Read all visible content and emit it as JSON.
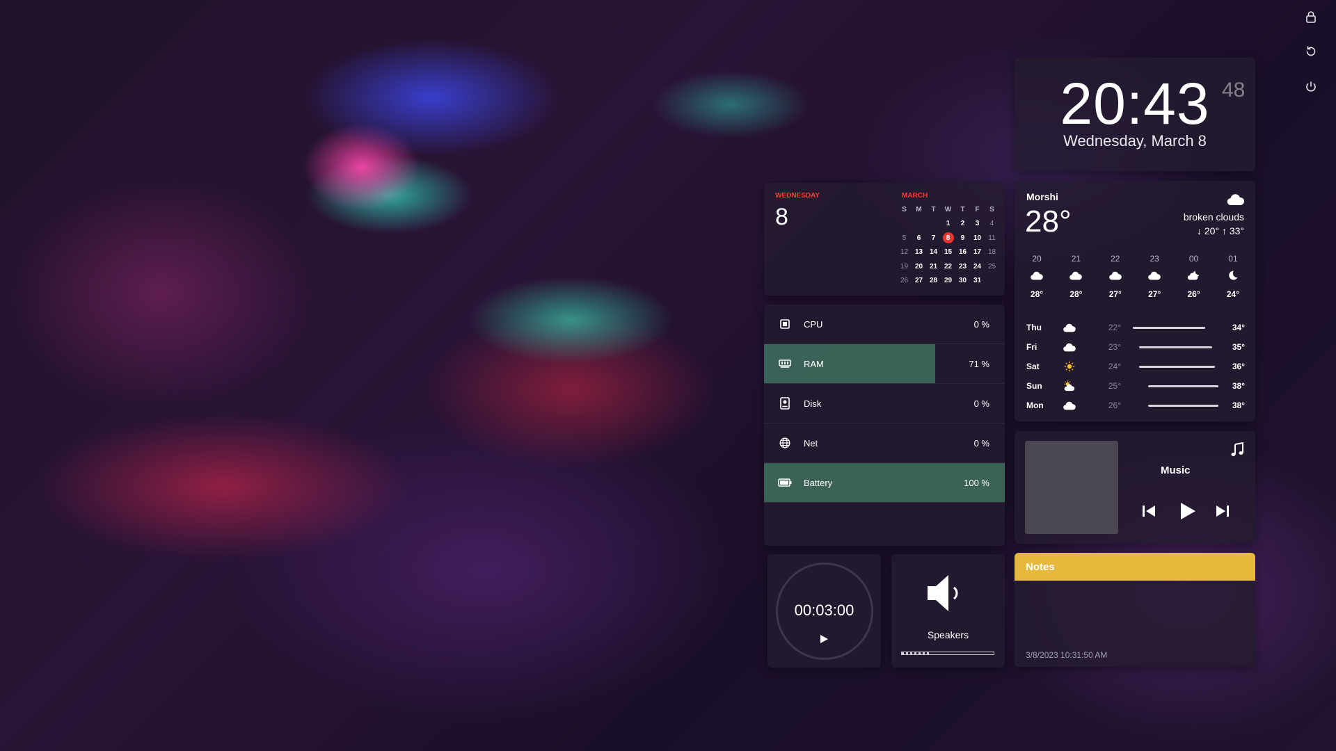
{
  "clock": {
    "time": "20:43",
    "seconds": "48",
    "date": "Wednesday, March 8"
  },
  "calendar": {
    "weekday": "WEDNESDAY",
    "day": "8",
    "month": "MARCH",
    "headers": [
      "S",
      "M",
      "T",
      "W",
      "T",
      "F",
      "S"
    ],
    "weeks": [
      [
        "",
        "",
        "",
        "1",
        "2",
        "3",
        "4"
      ],
      [
        "5",
        "6",
        "7",
        "8",
        "9",
        "10",
        "11"
      ],
      [
        "12",
        "13",
        "14",
        "15",
        "16",
        "17",
        "18"
      ],
      [
        "19",
        "20",
        "21",
        "22",
        "23",
        "24",
        "25"
      ],
      [
        "26",
        "27",
        "28",
        "29",
        "30",
        "31",
        ""
      ]
    ],
    "today": "8"
  },
  "system": {
    "rows": [
      {
        "label": "CPU",
        "value": "0 %",
        "fill": 0,
        "icon": "cpu-icon"
      },
      {
        "label": "RAM",
        "value": "71 %",
        "fill": 0.71,
        "icon": "ram-icon"
      },
      {
        "label": "Disk",
        "value": "0 %",
        "fill": 0,
        "icon": "disk-icon"
      },
      {
        "label": "Net",
        "value": "0 %",
        "fill": 0,
        "icon": "globe-icon"
      },
      {
        "label": "Battery",
        "value": "100 %",
        "fill": 1.0,
        "icon": "battery-icon"
      }
    ],
    "fill_color": "#46826a"
  },
  "weather": {
    "city": "Morshi",
    "temp": "28°",
    "description": "broken clouds",
    "low": "20°",
    "high": "33°",
    "hourly": [
      {
        "hour": "20",
        "temp": "28°",
        "icon": "cloud-icon"
      },
      {
        "hour": "21",
        "temp": "28°",
        "icon": "cloud-icon"
      },
      {
        "hour": "22",
        "temp": "27°",
        "icon": "cloud-icon"
      },
      {
        "hour": "23",
        "temp": "27°",
        "icon": "cloud-icon"
      },
      {
        "hour": "00",
        "temp": "26°",
        "icon": "cloud-moon-icon"
      },
      {
        "hour": "01",
        "temp": "24°",
        "icon": "moon-icon"
      }
    ],
    "daily": [
      {
        "day": "Thu",
        "low": "22°",
        "high": "34°",
        "icon": "cloud-icon",
        "bar_start": 0.05,
        "bar_end": 0.85
      },
      {
        "day": "Fri",
        "low": "23°",
        "high": "35°",
        "icon": "cloud-icon",
        "bar_start": 0.12,
        "bar_end": 0.93
      },
      {
        "day": "Sat",
        "low": "24°",
        "high": "36°",
        "icon": "sun-icon",
        "bar_start": 0.12,
        "bar_end": 0.96
      },
      {
        "day": "Sun",
        "low": "25°",
        "high": "38°",
        "icon": "sun-cloud-icon",
        "bar_start": 0.22,
        "bar_end": 1.0
      },
      {
        "day": "Mon",
        "low": "26°",
        "high": "38°",
        "icon": "cloud-icon",
        "bar_start": 0.22,
        "bar_end": 1.0
      }
    ]
  },
  "music": {
    "title": "Music"
  },
  "notes": {
    "title": "Notes",
    "timestamp": "3/8/2023 10:31:50 AM",
    "header_color": "#e8b83a"
  },
  "timer": {
    "time": "00:03:00"
  },
  "speakers": {
    "label": "Speakers",
    "volume": 0.3
  },
  "top_icons": [
    "lock-icon",
    "restart-icon",
    "power-icon"
  ]
}
